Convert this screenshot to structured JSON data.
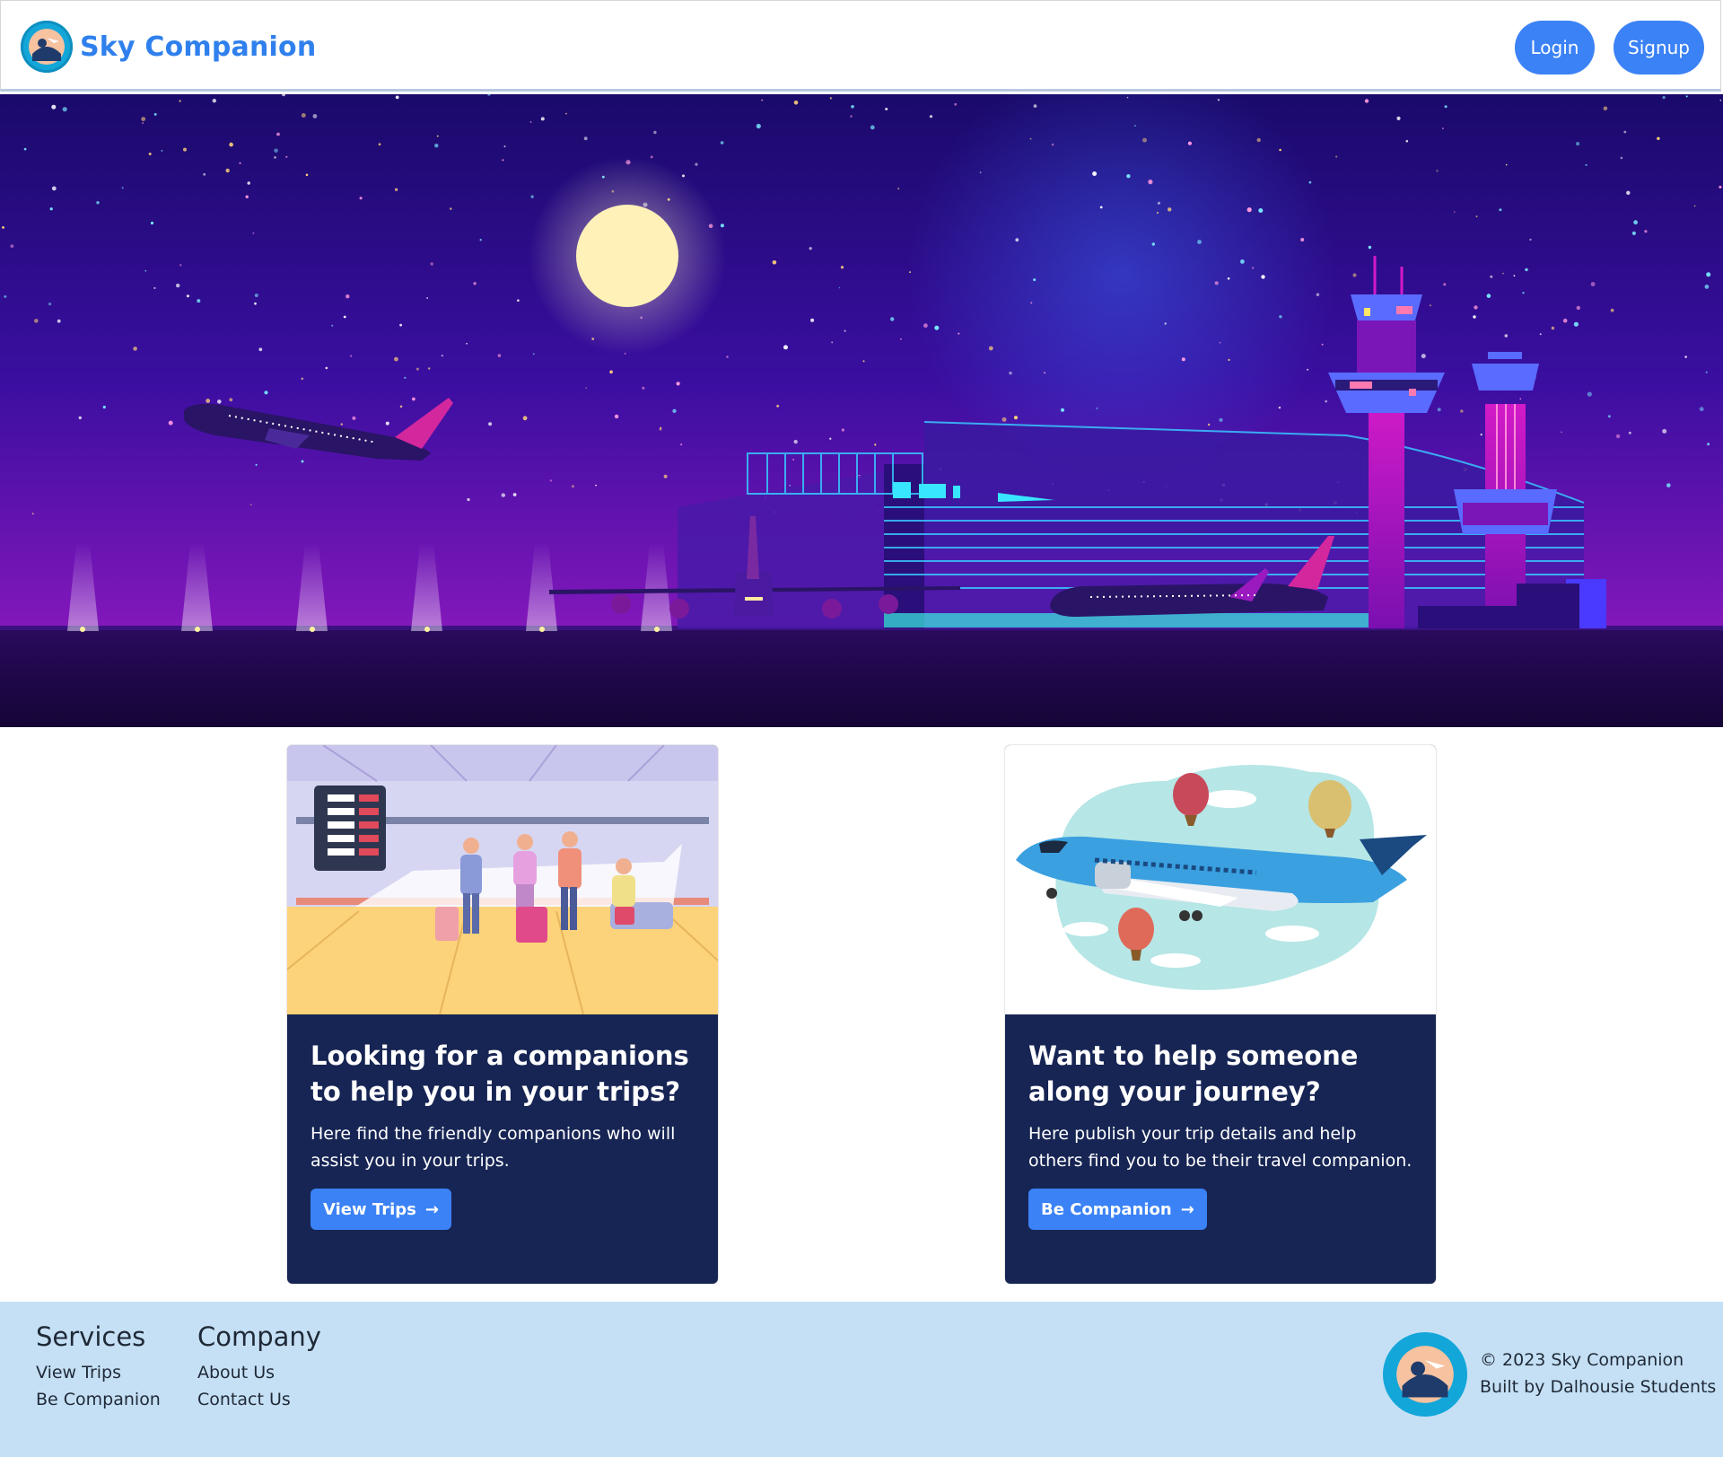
{
  "navbar": {
    "brand": "Sky Companion",
    "login_label": "Login",
    "signup_label": "Signup"
  },
  "cards": [
    {
      "title": "Looking for a companions to help you in your trips?",
      "text": "Here find the friendly companions who will assist you in your trips.",
      "button_label": "View Trips"
    },
    {
      "title": "Want to help someone along your journey?",
      "text": "Here publish your trip details and help others find you to be their travel companion.",
      "button_label": "Be Companion"
    }
  ],
  "footer": {
    "services_heading": "Services",
    "services_links": [
      "View Trips",
      "Be Companion"
    ],
    "company_heading": "Company",
    "company_links": [
      "About Us",
      "Contact Us"
    ],
    "copyright": "© 2023 Sky Companion",
    "built_by": "Built by Dalhousie Students"
  },
  "colors": {
    "brand": "#2f80ed",
    "primary_button": "#3b82f6",
    "card_bg": "#172554",
    "footer_bg": "#c5e0f5"
  }
}
